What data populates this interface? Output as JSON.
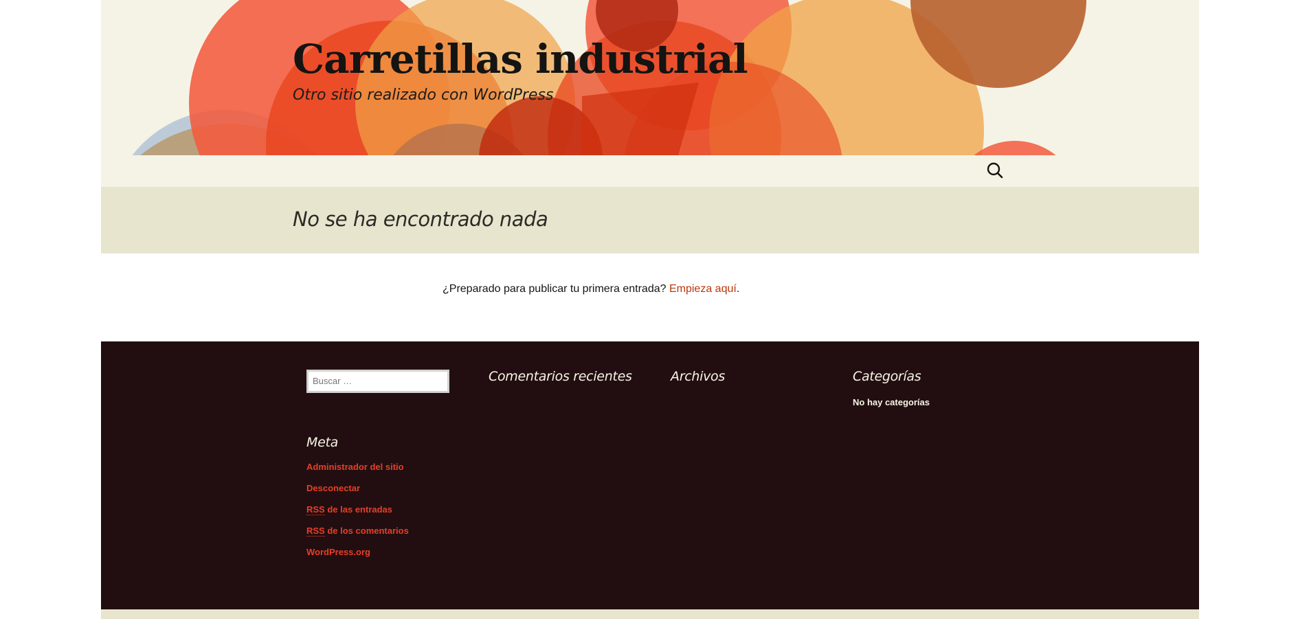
{
  "header": {
    "site_title": "Carretillas industrial",
    "site_description": "Otro sitio realizado con WordPress",
    "search_icon": "search-icon"
  },
  "main": {
    "page_title": "No se ha encontrado nada",
    "prompt_text": "¿Preparado para publicar tu primera entrada?",
    "prompt_link": "Empieza aquí",
    "prompt_end": "."
  },
  "footer": {
    "search_placeholder": "Buscar …",
    "recent_comments_title": "Comentarios recientes",
    "archives_title": "Archivos",
    "categories_title": "Categorías",
    "no_categories": "No hay categorías",
    "meta_title": "Meta",
    "meta_links": [
      {
        "pre": "",
        "label": "Administrador del sitio"
      },
      {
        "pre": "",
        "label": "Desconectar"
      },
      {
        "pre": "RSS",
        "label": " de las entradas"
      },
      {
        "pre": "RSS",
        "label": " de los comentarios"
      },
      {
        "pre": "",
        "label": "WordPress.org"
      }
    ]
  },
  "colors": {
    "header_bg": "#f5f3e6",
    "page_header_bg": "#e8e5ce",
    "footer_bg": "#220e10",
    "link_color": "#bc360a",
    "footer_link_color": "#e63f2a"
  }
}
